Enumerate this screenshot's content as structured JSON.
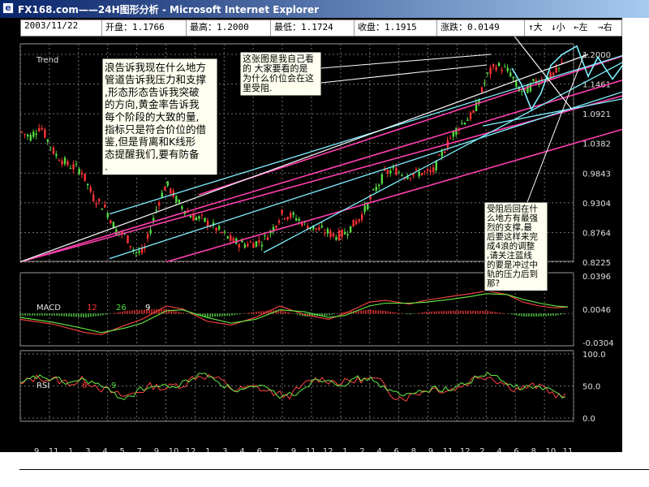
{
  "window": {
    "title": "FX168.com——24H图形分析 - Microsoft Internet Explorer",
    "icon": "ie-icon"
  },
  "infobar": {
    "date": "2003/11/22",
    "open": "开盘：1.1766",
    "high": "最高：1.2000",
    "low": "最低：1.1724",
    "close": "收盘：1.1915",
    "change": "涨跌：0.0149"
  },
  "nav": {
    "up": "↑大",
    "down": "↓小",
    "left": "←左",
    "right": "→右"
  },
  "colors": {
    "background": "#000000",
    "up_candle": "#ff3333",
    "down_candle": "#55dd44",
    "channel_pink": "#ff3fae",
    "channel_cyan": "#7ff0ff",
    "grid": "#6f6f6f",
    "label": "#e0e0e0"
  },
  "annotations": {
    "left": "浪告诉我现在什么地方管道告诉我压力和支撑,形态形态告诉我突破的方向,黄金率告诉我每个阶段的大致的量,指标只是符合价位的借鉴,但是背离和K线形态提醒我们,要有防备.",
    "top": "这张图是我自己看的 大家要看的是为什么价位会在这里受阻.",
    "right": "受阻后回在什么地方有最强烈的支撑,最后要这样来完成4浪的调整,请关注蓝线的要是冲过中轨的压力后到那?"
  },
  "chart_data": [
    {
      "type": "candlestick",
      "panel_label": "Trend",
      "y_ticks": [
        "1.2000",
        "1.1461",
        "1.0921",
        "1.0382",
        "0.9843",
        "0.9304",
        "0.8764",
        "0.8225"
      ],
      "ylim": [
        0.8225,
        1.2
      ],
      "x_tick_labels": [
        "9",
        "11",
        "1",
        "3",
        "4",
        "5",
        "7",
        "9",
        "10",
        "12",
        "1",
        "3",
        "4",
        "6",
        "7",
        "9",
        "11",
        "12",
        "1",
        "2",
        "4",
        "6",
        "8",
        "9",
        "11",
        "12",
        "2",
        "4",
        "6",
        "8",
        "10",
        "11"
      ],
      "price_path": [
        [
          0,
          1.06
        ],
        [
          12,
          1.05
        ],
        [
          25,
          1.07
        ],
        [
          42,
          1.02
        ],
        [
          58,
          1.0
        ],
        [
          75,
          0.99
        ],
        [
          90,
          0.94
        ],
        [
          105,
          0.92
        ],
        [
          118,
          0.88
        ],
        [
          130,
          0.87
        ],
        [
          142,
          0.84
        ],
        [
          152,
          0.84
        ],
        [
          160,
          0.88
        ],
        [
          170,
          0.93
        ],
        [
          180,
          0.965
        ],
        [
          195,
          0.93
        ],
        [
          212,
          0.905
        ],
        [
          225,
          0.9
        ],
        [
          245,
          0.88
        ],
        [
          262,
          0.86
        ],
        [
          278,
          0.855
        ],
        [
          298,
          0.86
        ],
        [
          310,
          0.88
        ],
        [
          322,
          0.91
        ],
        [
          338,
          0.905
        ],
        [
          352,
          0.89
        ],
        [
          372,
          0.88
        ],
        [
          390,
          0.87
        ],
        [
          400,
          0.875
        ],
        [
          420,
          0.905
        ],
        [
          440,
          0.96
        ],
        [
          450,
          0.985
        ],
        [
          462,
          0.99
        ],
        [
          475,
          0.98
        ],
        [
          492,
          0.985
        ],
        [
          508,
          0.985
        ],
        [
          520,
          1.02
        ],
        [
          535,
          1.06
        ],
        [
          548,
          1.08
        ],
        [
          558,
          1.09
        ],
        [
          566,
          1.12
        ],
        [
          575,
          1.16
        ],
        [
          586,
          1.18
        ],
        [
          595,
          1.175
        ],
        [
          605,
          1.165
        ],
        [
          612,
          1.14
        ],
        [
          622,
          1.13
        ],
        [
          634,
          1.15
        ],
        [
          645,
          1.155
        ],
        [
          655,
          1.16
        ],
        [
          664,
          1.172
        ],
        [
          671,
          1.191
        ]
      ],
      "channels": {
        "pink": [
          [
            [
              0,
              0.823
            ],
            [
              780,
              1.17
            ]
          ],
          [
            [
              220,
              0.945
            ],
            [
              780,
              1.215
            ]
          ],
          [
            [
              180,
              0.823
            ],
            [
              780,
              1.08
            ]
          ],
          [
            [
              0,
              0.823
            ],
            [
              780,
              1.14
            ]
          ]
        ],
        "cyan": [
          [
            [
              110,
              0.91
            ],
            [
              780,
              1.215
            ]
          ],
          [
            [
              110,
              0.829
            ],
            [
              780,
              1.15
            ]
          ],
          [
            [
              300,
              0.84
            ],
            [
              780,
              1.215
            ]
          ],
          [
            [
              570,
              1.07
            ],
            [
              780,
              1.13
            ]
          ]
        ],
        "white": [
          [
            [
              0,
              0.823
            ],
            [
              700,
              1.2
            ]
          ],
          [
            [
              600,
              1.25
            ],
            [
              680,
              1.1
            ]
          ]
        ]
      }
    },
    {
      "type": "line",
      "panel_label": "MACD",
      "params": [
        "12",
        "26",
        "9"
      ],
      "y_ticks": [
        "0.0396",
        "0.0046",
        "-0.0304"
      ],
      "ylim": [
        -0.0304,
        0.0396
      ],
      "series": [
        {
          "role": "dif",
          "color": "#ff4444",
          "points": [
            [
              0,
              -0.006
            ],
            [
              40,
              -0.011
            ],
            [
              80,
              -0.02
            ],
            [
              100,
              -0.022
            ],
            [
              130,
              -0.012
            ],
            [
              150,
              -0.006
            ],
            [
              180,
              0.008
            ],
            [
              200,
              0.005
            ],
            [
              230,
              -0.008
            ],
            [
              260,
              -0.012
            ],
            [
              290,
              -0.004
            ],
            [
              320,
              0.008
            ],
            [
              350,
              -0.001
            ],
            [
              380,
              -0.006
            ],
            [
              400,
              0.0
            ],
            [
              430,
              0.012
            ],
            [
              450,
              0.014
            ],
            [
              480,
              0.01
            ],
            [
              500,
              0.014
            ],
            [
              530,
              0.018
            ],
            [
              555,
              0.021
            ],
            [
              575,
              0.024
            ],
            [
              600,
              0.02
            ],
            [
              620,
              0.012
            ],
            [
              640,
              0.008
            ],
            [
              660,
              0.006
            ],
            [
              675,
              0.007
            ]
          ]
        },
        {
          "role": "dea",
          "color": "#66ee44",
          "points": [
            [
              0,
              -0.004
            ],
            [
              40,
              -0.009
            ],
            [
              80,
              -0.016
            ],
            [
              100,
              -0.02
            ],
            [
              130,
              -0.015
            ],
            [
              150,
              -0.01
            ],
            [
              180,
              0.003
            ],
            [
              200,
              0.004
            ],
            [
              230,
              -0.004
            ],
            [
              260,
              -0.01
            ],
            [
              290,
              -0.006
            ],
            [
              320,
              0.004
            ],
            [
              350,
              0.002
            ],
            [
              380,
              -0.004
            ],
            [
              400,
              -0.002
            ],
            [
              430,
              0.008
            ],
            [
              450,
              0.011
            ],
            [
              480,
              0.011
            ],
            [
              500,
              0.012
            ],
            [
              530,
              0.015
            ],
            [
              555,
              0.018
            ],
            [
              575,
              0.021
            ],
            [
              600,
              0.02
            ],
            [
              620,
              0.015
            ],
            [
              640,
              0.011
            ],
            [
              660,
              0.008
            ],
            [
              675,
              0.007
            ]
          ]
        }
      ]
    },
    {
      "type": "line",
      "panel_label": "RSI",
      "params": [
        "6",
        "9"
      ],
      "y_ticks": [
        "100.0",
        "50.0",
        "0.0"
      ],
      "ylim": [
        0,
        100
      ],
      "series": [
        {
          "role": "rsi6",
          "color": "#ff4444",
          "amplitude": 22
        },
        {
          "role": "rsi9",
          "color": "#66ee44",
          "amplitude": 16
        }
      ]
    }
  ]
}
